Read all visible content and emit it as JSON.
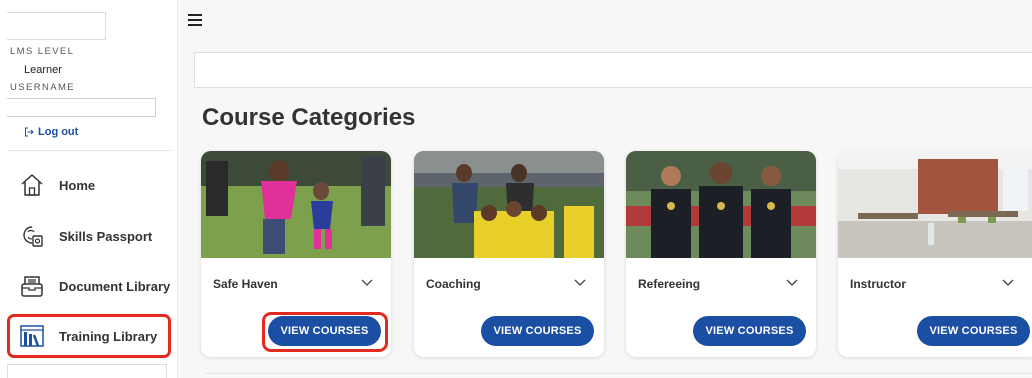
{
  "sidebar": {
    "lms_level_label": "LMS LEVEL",
    "lms_level_value": "Learner",
    "username_label": "USERNAME",
    "username_value": "",
    "logout_label": "Log out",
    "items": [
      {
        "label": "Home",
        "icon": "home-icon"
      },
      {
        "label": "Skills Passport",
        "icon": "passport-icon"
      },
      {
        "label": "Document Library",
        "icon": "document-library-icon"
      },
      {
        "label": "Training Library",
        "icon": "training-library-icon",
        "active": true
      }
    ]
  },
  "main": {
    "title": "Course Categories",
    "categories": [
      {
        "name": "Safe Haven",
        "button": "VIEW COURSES"
      },
      {
        "name": "Coaching",
        "button": "VIEW COURSES"
      },
      {
        "name": "Refereeing",
        "button": "VIEW COURSES"
      },
      {
        "name": "Instructor",
        "button": "VIEW COURSES"
      }
    ]
  },
  "colors": {
    "accent": "#1a4fa3",
    "highlight": "#e32a1e",
    "background": "#f7f7f7"
  }
}
